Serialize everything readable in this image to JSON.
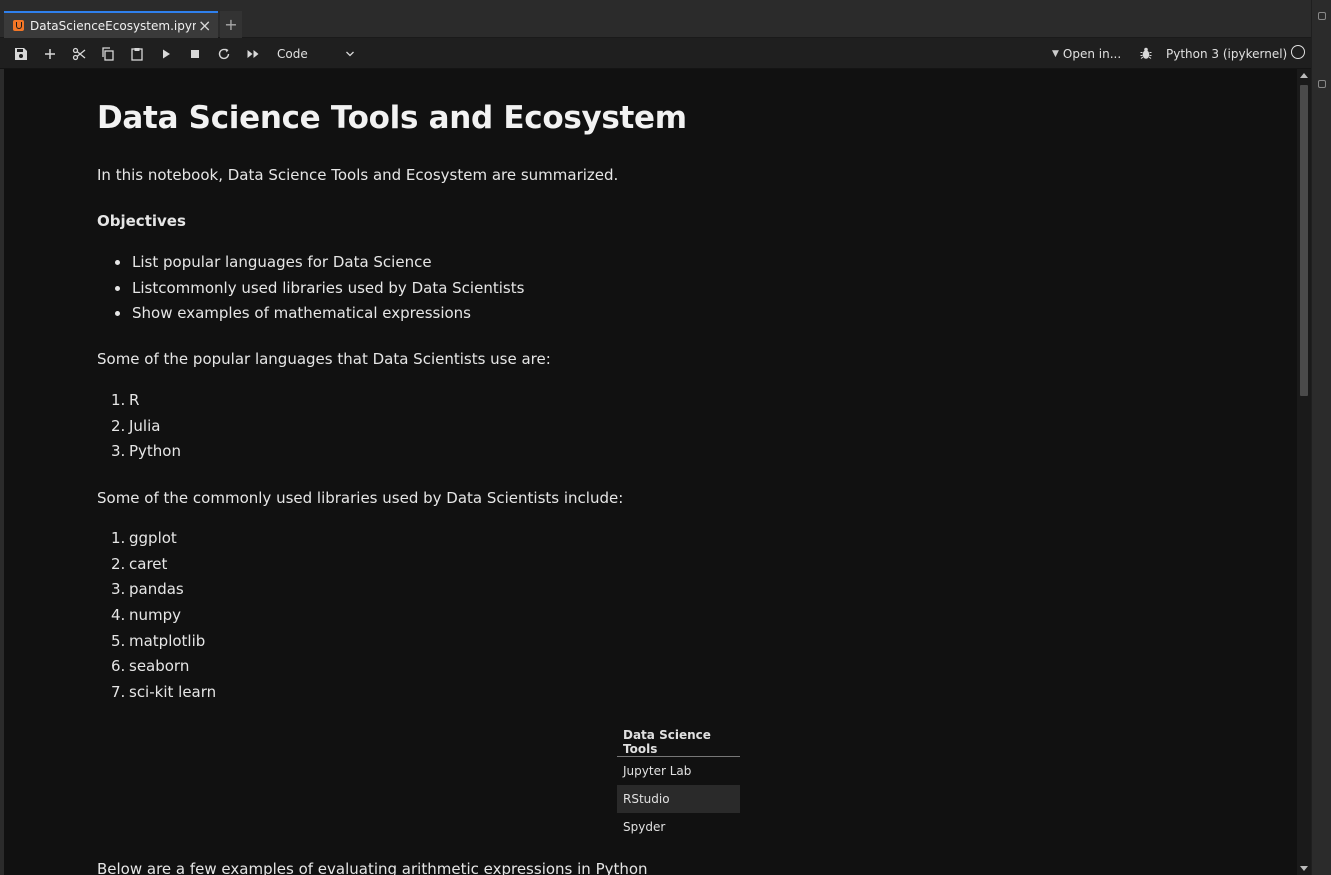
{
  "tab": {
    "label": "DataScienceEcosystem.ipynb",
    "close": "×",
    "add": "+"
  },
  "toolbar": {
    "cell_type": "Code",
    "open_in": "Open in...",
    "kernel": "Python 3 (ipykernel)",
    "buttons": [
      "save-icon",
      "add-cell-icon",
      "cut-icon",
      "copy-icon",
      "paste-icon",
      "run-icon",
      "stop-icon",
      "restart-icon",
      "run-all-icon"
    ]
  },
  "notebook": {
    "title": "Data Science Tools and Ecosystem",
    "intro": "In this notebook, Data Science Tools and Ecosystem are summarized.",
    "objectives_heading": "Objectives",
    "objectives": [
      "List popular languages for Data Science",
      "Listcommonly used libraries used by Data Scientists",
      "Show examples of mathematical expressions"
    ],
    "languages_intro": "Some of the popular languages that Data Scientists use are:",
    "languages": [
      "R",
      "Julia",
      "Python"
    ],
    "libraries_intro": "Some of the commonly used libraries used by Data Scientists include:",
    "libraries": [
      "ggplot",
      "caret",
      "pandas",
      "numpy",
      "matplotlib",
      "seaborn",
      "sci-kit learn"
    ],
    "tools_table": {
      "header": "Data Science Tools",
      "rows": [
        "Jupyter Lab",
        "RStudio",
        "Spyder"
      ]
    },
    "arith_intro": "Below are a few examples of evaluating arithmetic expressions in Python"
  },
  "colors": {
    "accent": "#2f80ed",
    "notebook_bg": "#111111",
    "toolbar_bg": "#1f1f1f",
    "tab_icon": "#f37626"
  }
}
